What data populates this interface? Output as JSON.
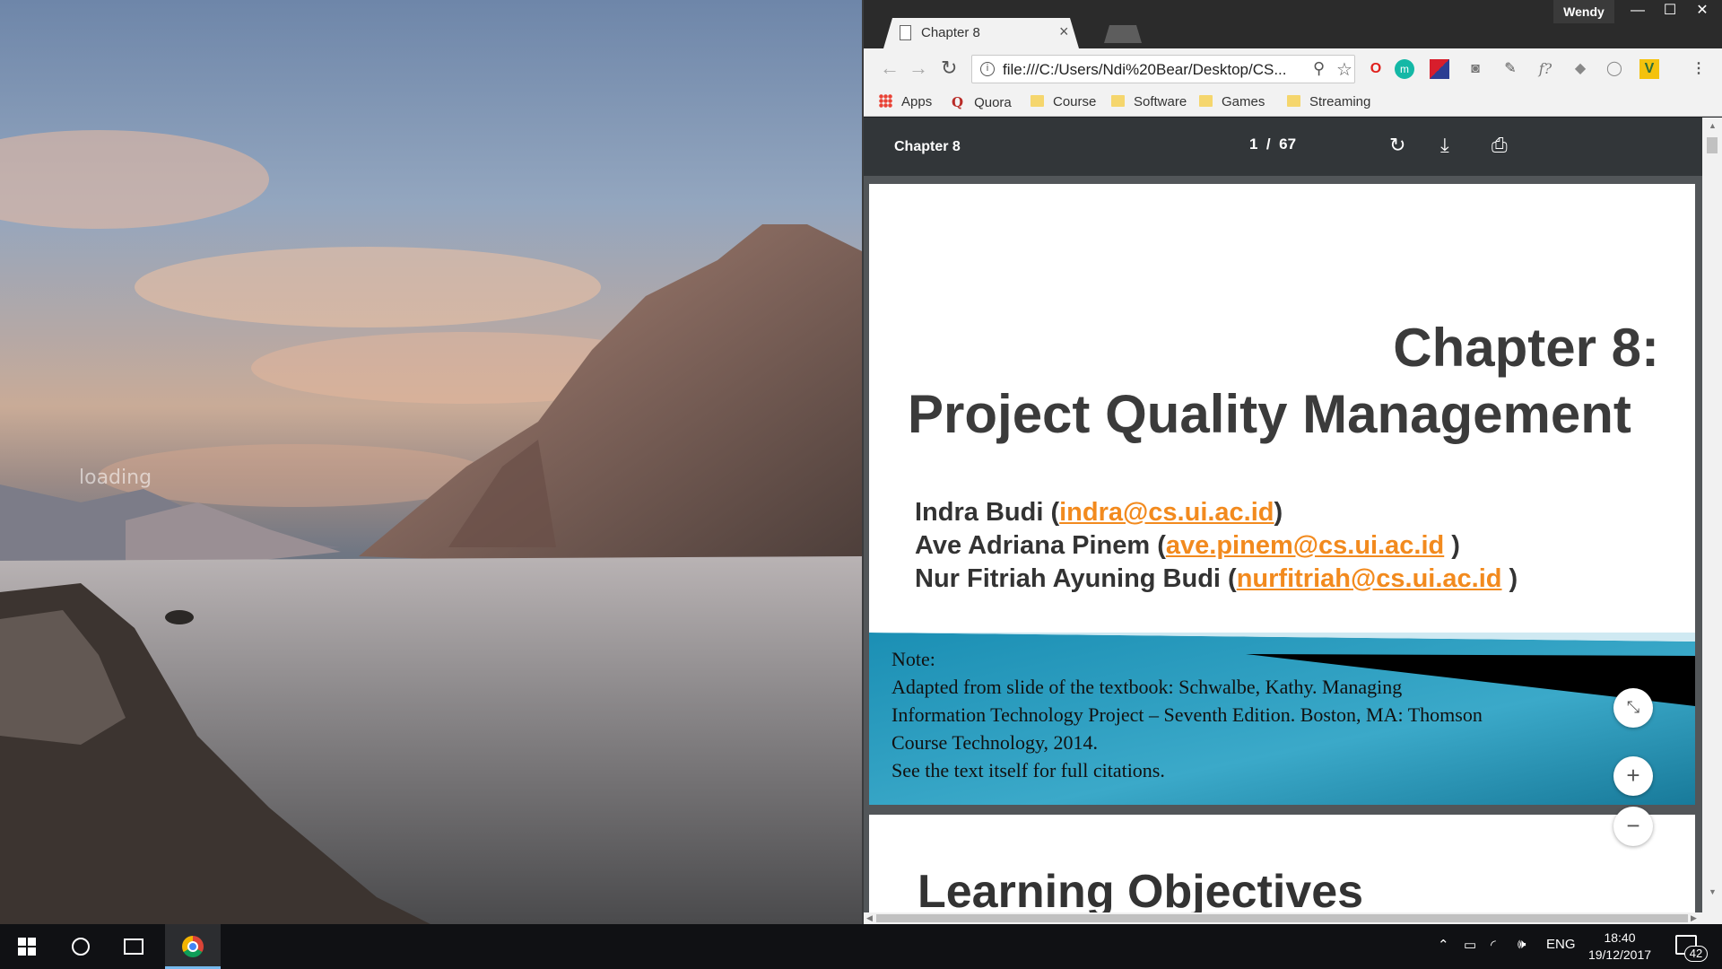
{
  "desktop": {
    "loading_text": "loading"
  },
  "browser": {
    "profile_name": "Wendy",
    "tab": {
      "title": "Chapter 8",
      "close_glyph": "×"
    },
    "window_controls": {
      "minimize": "—",
      "maximize": "☐",
      "close": "✕"
    },
    "url": "file:///C:/Users/Ndi%20Bear/Desktop/CS...",
    "bookmarks": [
      {
        "label": "Apps",
        "icon": "apps-grid-icon"
      },
      {
        "label": "Quora",
        "icon": "quora-icon"
      },
      {
        "label": "Course",
        "icon": "folder-icon"
      },
      {
        "label": "Software",
        "icon": "folder-icon"
      },
      {
        "label": "Games",
        "icon": "folder-icon"
      },
      {
        "label": "Streaming",
        "icon": "folder-icon"
      }
    ],
    "extensions": [
      "opera-icon",
      "m-extension-icon",
      "flag-extension-icon",
      "camera-icon",
      "eyedropper-icon",
      "formula-icon",
      "layers-icon",
      "cursor-extension-icon",
      "v-extension-icon"
    ]
  },
  "pdf": {
    "title": "Chapter 8",
    "page_current": "1",
    "page_separator": "/",
    "page_total": "67",
    "slide": {
      "title_line1": "Chapter 8:",
      "title_line2": "Project Quality Management",
      "authors": [
        {
          "name": "Indra Budi (",
          "email": "indra@cs.ui.ac.id",
          "suffix": ")"
        },
        {
          "name": "Ave Adriana Pinem (",
          "email": "ave.pinem@cs.ui.ac.id",
          "suffix": " )"
        },
        {
          "name": "Nur Fitriah Ayuning Budi (",
          "email": "nurfitriah@cs.ui.ac.id",
          "suffix": " )"
        }
      ],
      "note_lines": [
        "Note:",
        "Adapted from slide of the textbook: Schwalbe, Kathy. Managing",
        "Information Technology Project – Seventh Edition. Boston, MA: Thomson",
        "Course Technology, 2014.",
        "See the text itself for full citations."
      ]
    },
    "next_slide_title": "Learning Objectives",
    "zoom_buttons": {
      "plus": "+",
      "minus": "−"
    }
  },
  "taskbar": {
    "language": "ENG",
    "time": "18:40",
    "date": "19/12/2017",
    "notification_count": "42"
  },
  "colors": {
    "email_link": "#f28a1e",
    "pdf_toolbar": "#323639",
    "taskbar": "#101114"
  }
}
